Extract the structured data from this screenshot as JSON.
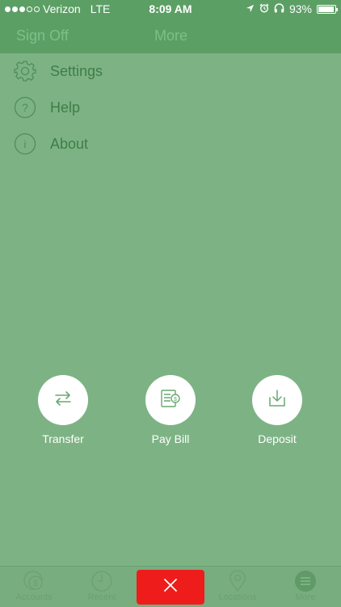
{
  "status_bar": {
    "carrier": "Verizon",
    "network": "LTE",
    "time": "8:09 AM",
    "battery": "93%",
    "battery_level": 0.93,
    "signal_bars": 3,
    "signal_total": 5
  },
  "header": {
    "sign_off_label": "Sign Off",
    "title": "More"
  },
  "menu": {
    "items": [
      {
        "label": "Settings",
        "icon": "gear-icon"
      },
      {
        "label": "Help",
        "icon": "question-circle-icon"
      },
      {
        "label": "About",
        "icon": "info-circle-icon"
      }
    ]
  },
  "actions": [
    {
      "label": "Transfer",
      "icon": "transfer-arrows-icon"
    },
    {
      "label": "Pay Bill",
      "icon": "bill-icon"
    },
    {
      "label": "Deposit",
      "icon": "deposit-tray-icon"
    }
  ],
  "tabbar": {
    "tabs": [
      {
        "label": "Accounts",
        "icon": "dollar-coin-icon"
      },
      {
        "label": "Recent",
        "icon": "clock-icon"
      },
      {
        "label": "",
        "icon": "close-icon"
      },
      {
        "label": "Locations",
        "icon": "location-pin-icon"
      },
      {
        "label": "More",
        "icon": "hamburger-menu-icon"
      }
    ]
  },
  "colors": {
    "background": "#7db384",
    "header": "#5c9f65",
    "menu_text": "#3f7d48",
    "close_button": "#ef1c1c"
  }
}
